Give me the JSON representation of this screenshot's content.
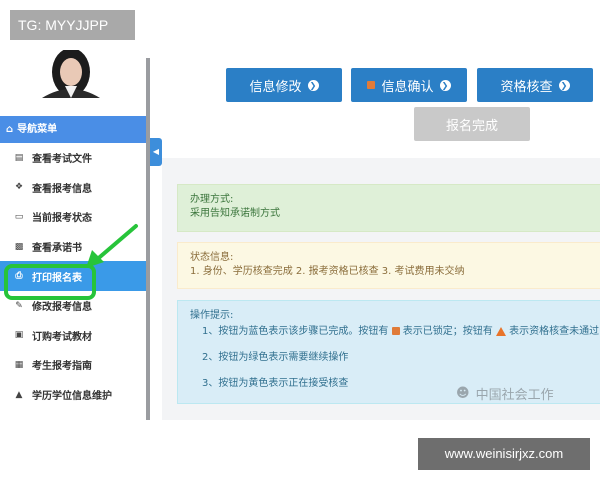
{
  "watermarks": {
    "top_left": "TG: MYYJJPP",
    "bottom_right": "www.weinisirjxz.com",
    "wechat": "中国社会工作"
  },
  "sidebar": {
    "header": "导航菜单",
    "items": [
      {
        "label": "查看考试文件",
        "icon": "file-icon"
      },
      {
        "label": "查看报考信息",
        "icon": "info-icon"
      },
      {
        "label": "当前报考状态",
        "icon": "monitor-icon"
      },
      {
        "label": "查看承诺书",
        "icon": "card-icon"
      },
      {
        "label": "打印报名表",
        "icon": "print-icon",
        "active": true
      },
      {
        "label": "修改报考信息",
        "icon": "edit-icon"
      },
      {
        "label": "订购考试教材",
        "icon": "cart-icon"
      },
      {
        "label": "考生报考指南",
        "icon": "book-icon"
      },
      {
        "label": "学历学位信息维护",
        "icon": "graduation-cap-icon"
      }
    ]
  },
  "buttons": {
    "modify": "信息修改",
    "confirm": "信息确认",
    "verify": "资格核查",
    "complete": "报名完成"
  },
  "panels": {
    "method_title": "办理方式:",
    "method_text": "采用告知承诺制方式",
    "status_title": "状态信息:",
    "status_text": "1. 身份、学历核查完成 2. 报考资格已核查 3. 考试费用未交纳",
    "tips_title": "操作提示:",
    "tip1_a": "1、按钮为蓝色表示该步骤已完成。按钮有",
    "tip1_b": "表示已锁定；按钮有",
    "tip1_c": "表示资格核查未通过，",
    "tip2": "2、按钮为绿色表示需要继续操作",
    "tip3": "3、按钮为黄色表示正在接受核查"
  },
  "colors": {
    "accent": "#2b7fc6",
    "highlight": "#27c43a"
  }
}
